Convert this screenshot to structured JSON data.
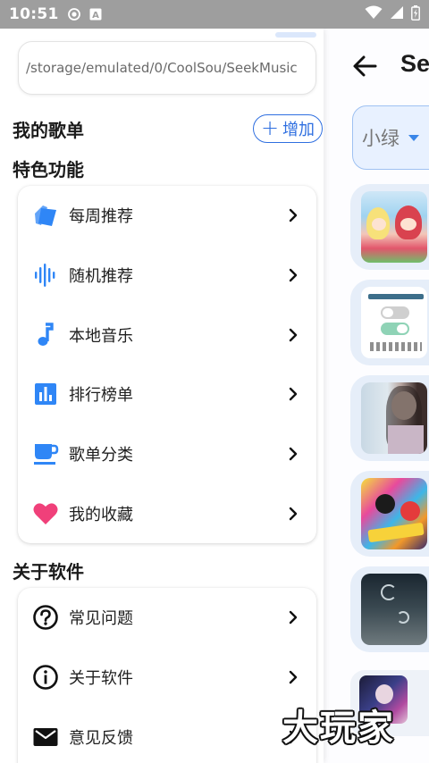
{
  "status_bar": {
    "time": "10:51"
  },
  "background_page": {
    "title": "Se",
    "dropdown_value": "小绿"
  },
  "drawer": {
    "path_value": "/storage/emulated/0/CoolSou/SeekMusic",
    "my_playlists_title": "我的歌单",
    "add_button_label": "增加",
    "features_title": "特色功能",
    "features": [
      {
        "label": "每周推荐",
        "icon": "tags-icon"
      },
      {
        "label": "随机推荐",
        "icon": "sound-wave-icon"
      },
      {
        "label": "本地音乐",
        "icon": "music-note-icon"
      },
      {
        "label": "排行榜单",
        "icon": "bar-chart-icon"
      },
      {
        "label": "歌单分类",
        "icon": "cup-icon"
      },
      {
        "label": "我的收藏",
        "icon": "heart-icon"
      }
    ],
    "about_title": "关于软件",
    "about_items": [
      {
        "label": "常见问题",
        "icon": "question-icon"
      },
      {
        "label": "关于软件",
        "icon": "info-icon"
      },
      {
        "label": "意见反馈",
        "icon": "mail-icon"
      }
    ]
  },
  "watermark_text": "大玩家",
  "colors": {
    "accent": "#2f6fe0",
    "icon_blue": "#2f86f6",
    "heart": "#f0407a",
    "status_bar": "#9e9e9e"
  }
}
